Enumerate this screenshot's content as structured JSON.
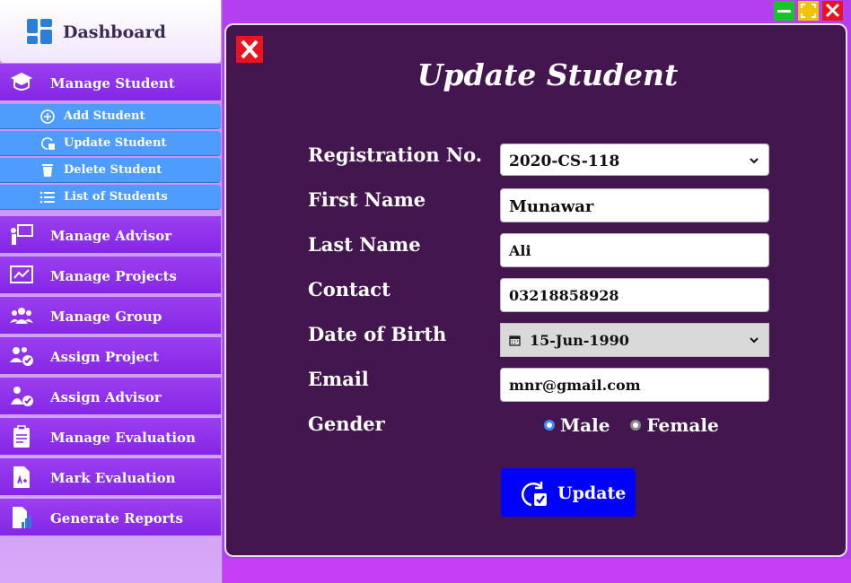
{
  "sidebar": {
    "dashboard_label": "Dashboard",
    "menu": [
      {
        "label": "Manage Student",
        "icon": "graduation-cap-icon"
      },
      {
        "label": "Manage Advisor",
        "icon": "teacher-board-icon"
      },
      {
        "label": "Manage Projects",
        "icon": "chart-presentation-icon"
      },
      {
        "label": "Manage Group",
        "icon": "group-icon"
      },
      {
        "label": "Assign Project",
        "icon": "users-check-icon"
      },
      {
        "label": "Assign Advisor",
        "icon": "user-check-icon"
      },
      {
        "label": "Manage Evaluation",
        "icon": "clipboard-icon"
      },
      {
        "label": "Mark Evaluation",
        "icon": "grade-document-icon"
      },
      {
        "label": "Generate Reports",
        "icon": "report-icon"
      }
    ],
    "submenu": [
      {
        "label": "Add Student",
        "icon": "plus-circle-icon"
      },
      {
        "label": "Update Student",
        "icon": "refresh-check-icon"
      },
      {
        "label": "Delete Student",
        "icon": "trash-icon"
      },
      {
        "label": "List of Students",
        "icon": "list-icon"
      }
    ]
  },
  "form": {
    "title": "Update Student",
    "labels": {
      "registration": "Registration No.",
      "first_name": "First Name",
      "last_name": "Last Name",
      "contact": "Contact",
      "dob": "Date of Birth",
      "email": "Email",
      "gender": "Gender"
    },
    "values": {
      "registration": "2020-CS-118",
      "first_name": "Munawar",
      "last_name": "Ali",
      "contact": "03218858928",
      "dob": "15-Jun-1990",
      "email": "mnr@gmail.com"
    },
    "gender_options": {
      "male": "Male",
      "female": "Female",
      "selected": "Male"
    },
    "update_label": "Update"
  },
  "colors": {
    "panel": "#44164f",
    "menu": "#8526e6",
    "submenu": "#4f9cff",
    "update_button": "#0000ff",
    "close_button": "#e8141f"
  }
}
